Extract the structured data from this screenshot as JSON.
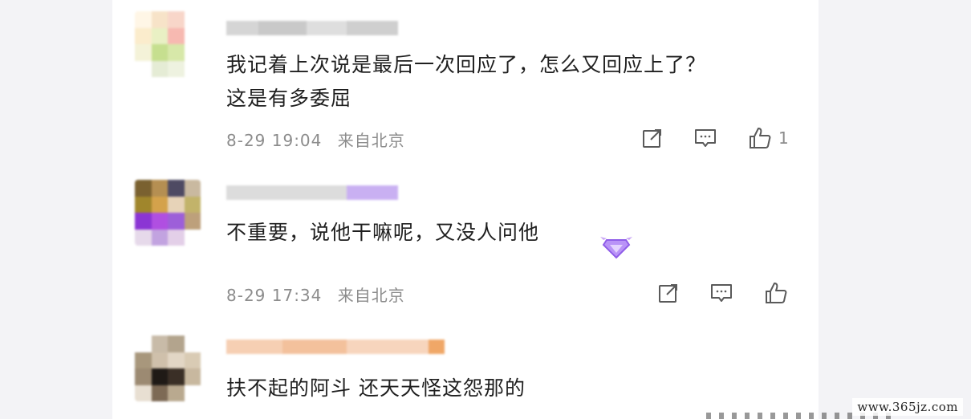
{
  "comments": [
    {
      "text_line1": "我记着上次说是最后一次回应了，怎么又回应上了？",
      "text_line2": "这是有多委屈",
      "time": "8-29 19:04",
      "location": "来自北京",
      "like_count": "1",
      "icons": [
        "share-icon",
        "comment-icon",
        "like-icon"
      ]
    },
    {
      "text_line1": "不重要，说他干嘛呢，又没人问他",
      "time": "8-29 17:34",
      "location": "来自北京",
      "like_count": "",
      "icons": [
        "share-icon",
        "comment-icon",
        "like-icon",
        "diamond-badge-icon"
      ]
    },
    {
      "text_line1": "扶不起的阿斗 还天天怪这怨那的"
    }
  ],
  "watermark": "www.365jz.com",
  "colors": {
    "text": "#1f1f1f",
    "meta": "#8c8c8c",
    "icon": "#5a5a5a",
    "badge": "#9b6bf0"
  }
}
